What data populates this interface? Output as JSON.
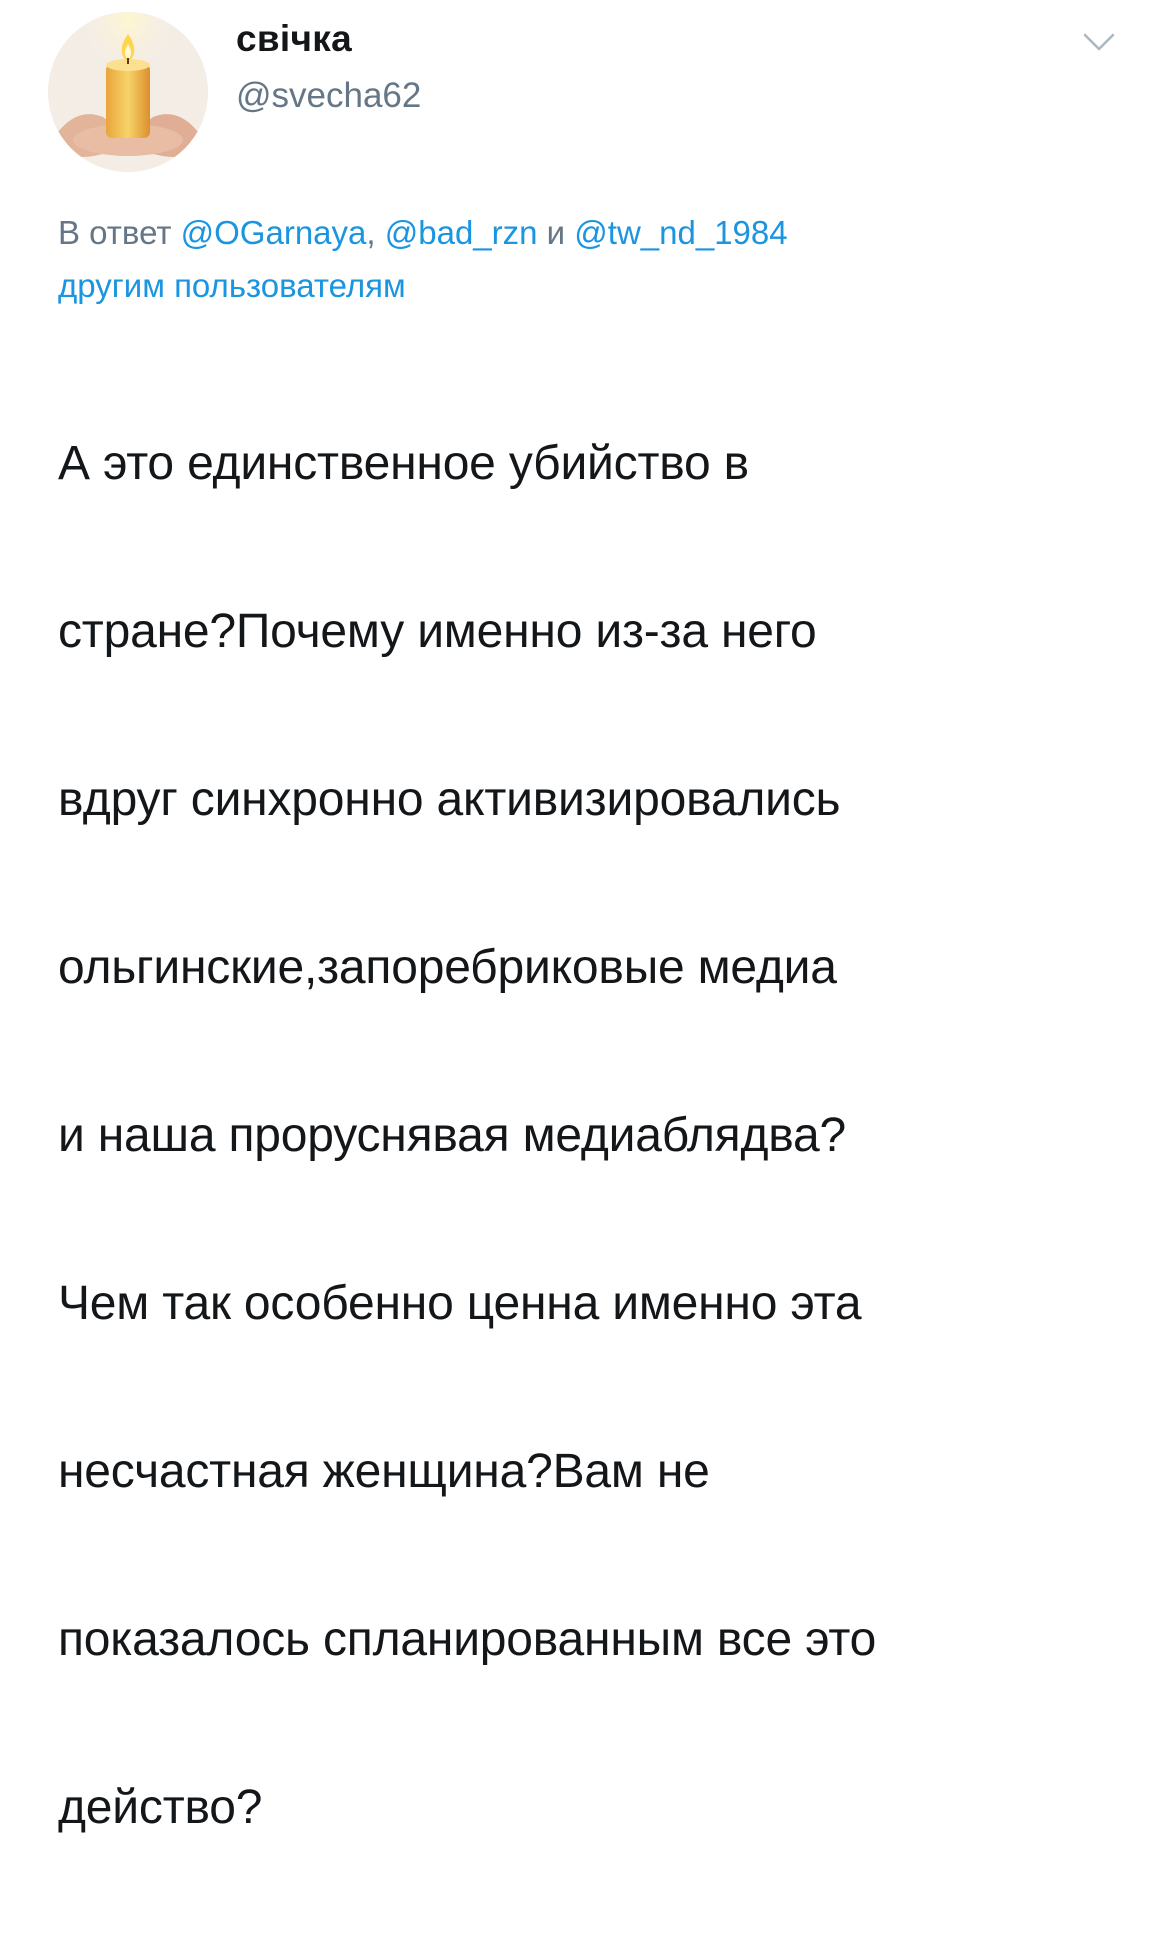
{
  "tweet": {
    "author": {
      "display_name": "свічка",
      "handle": "@svecha62",
      "avatar_icon": "candle-in-hands-avatar"
    },
    "menu_icon": "chevron-down-icon",
    "reply_to": {
      "prefix": "В ответ",
      "mentions": [
        "@OGarnaya",
        "@bad_rzn",
        "@tw_nd_1984"
      ],
      "separator_1": ", ",
      "conjunction": " и ",
      "suffix": "другим пользователям"
    },
    "text_lines": [
      "А это единственное убийство в",
      "стране?Почему именно из-за него",
      "вдруг синхронно активизировались",
      "ольгинские,запоребриковые медиа",
      "и наша проруснявая медиаблядва?",
      "Чем так особенно ценна именно эта",
      "несчастная женщина?Вам не",
      "показалось спланированным все это",
      "действо?"
    ]
  },
  "colors": {
    "text": "#14171a",
    "secondary": "#657786",
    "link": "#1b95e0",
    "background": "#ffffff"
  }
}
